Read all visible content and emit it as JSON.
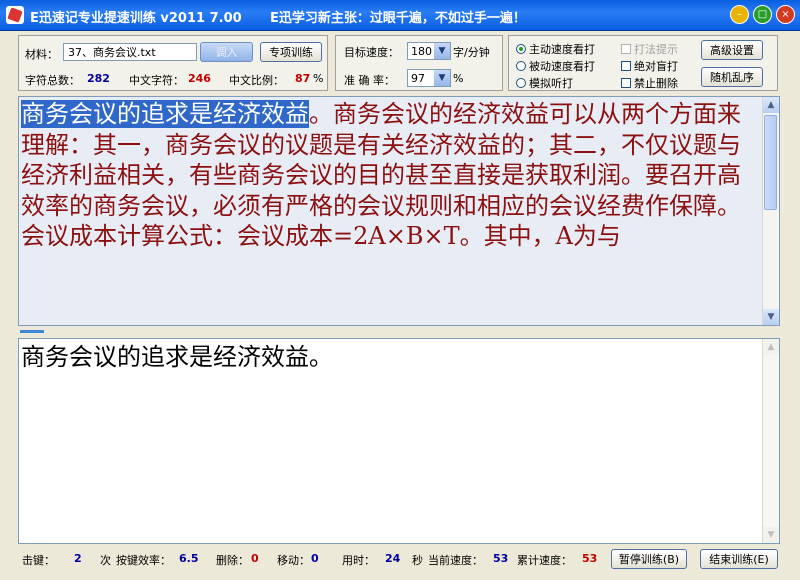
{
  "title": {
    "app": "E迅速记专业提速训练 v2011  7.00",
    "slogan": "E迅学习新主张：过眼千遍，不如过手一遍！"
  },
  "material": {
    "label": "材料：",
    "file": "37、商务会议.txt",
    "load_button": "调入",
    "special_button": "专项训练",
    "total_chars_label": "字符总数：",
    "total_chars": "282",
    "chinese_chars_label": "中文字符：",
    "chinese_chars": "246",
    "chinese_ratio_label": "中文比例：",
    "chinese_ratio": "87",
    "percent": "%"
  },
  "targets": {
    "speed_label": "目标速度：",
    "speed_value": "180",
    "speed_unit": "字/分钟",
    "accuracy_label": "准 确 率：",
    "accuracy_value": "97",
    "accuracy_unit": "%"
  },
  "options": {
    "radio_active": "主动速度看打",
    "radio_passive": "被动速度看打",
    "radio_listen": "模拟听打",
    "check_hint": "打法提示",
    "check_blind": "绝对盲打",
    "check_nodelete": "禁止删除",
    "advanced_button": "高级设置",
    "random_button": "随机乱序"
  },
  "source": {
    "highlight": "商务会议的追求是经济效益",
    "rest": "。商务会议的经济效益可以从两个方面来理解：其一，商务会议的议题是有关经济效益的；其二，不仅议题与经济利益相关，有些商务会议的目的甚至直接是获取利润。要召开高效率的商务会议，必须有严格的会议规则和相应的会议经费作保障。会议成本计算公式：会议成本=2A×B×T。其中，A为与"
  },
  "typed": {
    "text": "商务会议的追求是经济效益。"
  },
  "status": {
    "keys_label": "击键：",
    "keys_value": "2",
    "count_label": "次",
    "key_eff_label": "按键效率：",
    "key_eff_value": "6.5",
    "delete_label": "删除：",
    "delete_value": "0",
    "move_label": "移动：",
    "move_value": "0",
    "time_label": "用时：",
    "time_value": "24",
    "time_unit": "秒",
    "cur_speed_label": "当前速度：",
    "cur_speed_value": "53",
    "cum_speed_label": "累计速度：",
    "cum_speed_value": "53",
    "pause_button": "暂停训练(B)",
    "end_button": "结束训练(E)"
  }
}
